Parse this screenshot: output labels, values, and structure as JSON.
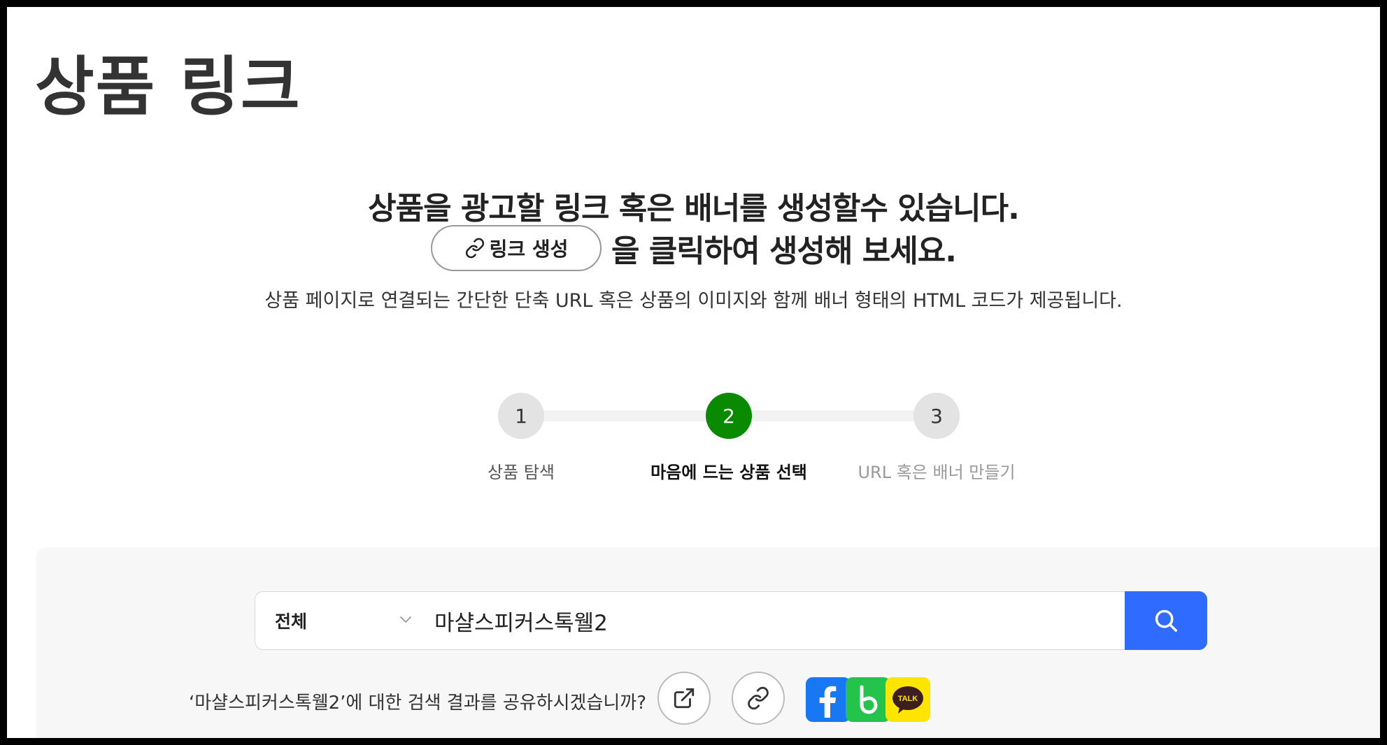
{
  "page": {
    "title": "상품 링크"
  },
  "intro": {
    "line1": "상품을 광고할 링크 혹은 배너를 생성할수 있습니다.",
    "create_button_label": "링크 생성",
    "line2_suffix": "을 클릭하여 생성해 보세요.",
    "description": "상품 페이지로 연결되는 간단한 단축 URL 혹은 상품의 이미지와 함께 배너 형태의 HTML 코드가 제공됩니다."
  },
  "steps": [
    {
      "number": "1",
      "label": "상품 탐색",
      "state": "done"
    },
    {
      "number": "2",
      "label": "마음에 드는 상품 선택",
      "state": "active"
    },
    {
      "number": "3",
      "label": "URL 혹은 배너 만들기",
      "state": "pending"
    }
  ],
  "search": {
    "category": "전체",
    "query": "마샬스피커스톡웰2"
  },
  "share": {
    "text": "‘마샬스피커스톡웰2’에 대한 검색 결과를 공유하시겠습니까?",
    "kakao_label": "TALK"
  },
  "colors": {
    "active_step": "#0a8a00",
    "search_button": "#2f6bff",
    "facebook": "#1877f2",
    "band": "#24c34b",
    "kakao": "#fee500"
  },
  "icons": [
    "link-icon",
    "chevron-down-icon",
    "search-icon",
    "external-share-icon",
    "copy-link-icon",
    "facebook-icon",
    "band-icon",
    "kakaotalk-icon"
  ]
}
